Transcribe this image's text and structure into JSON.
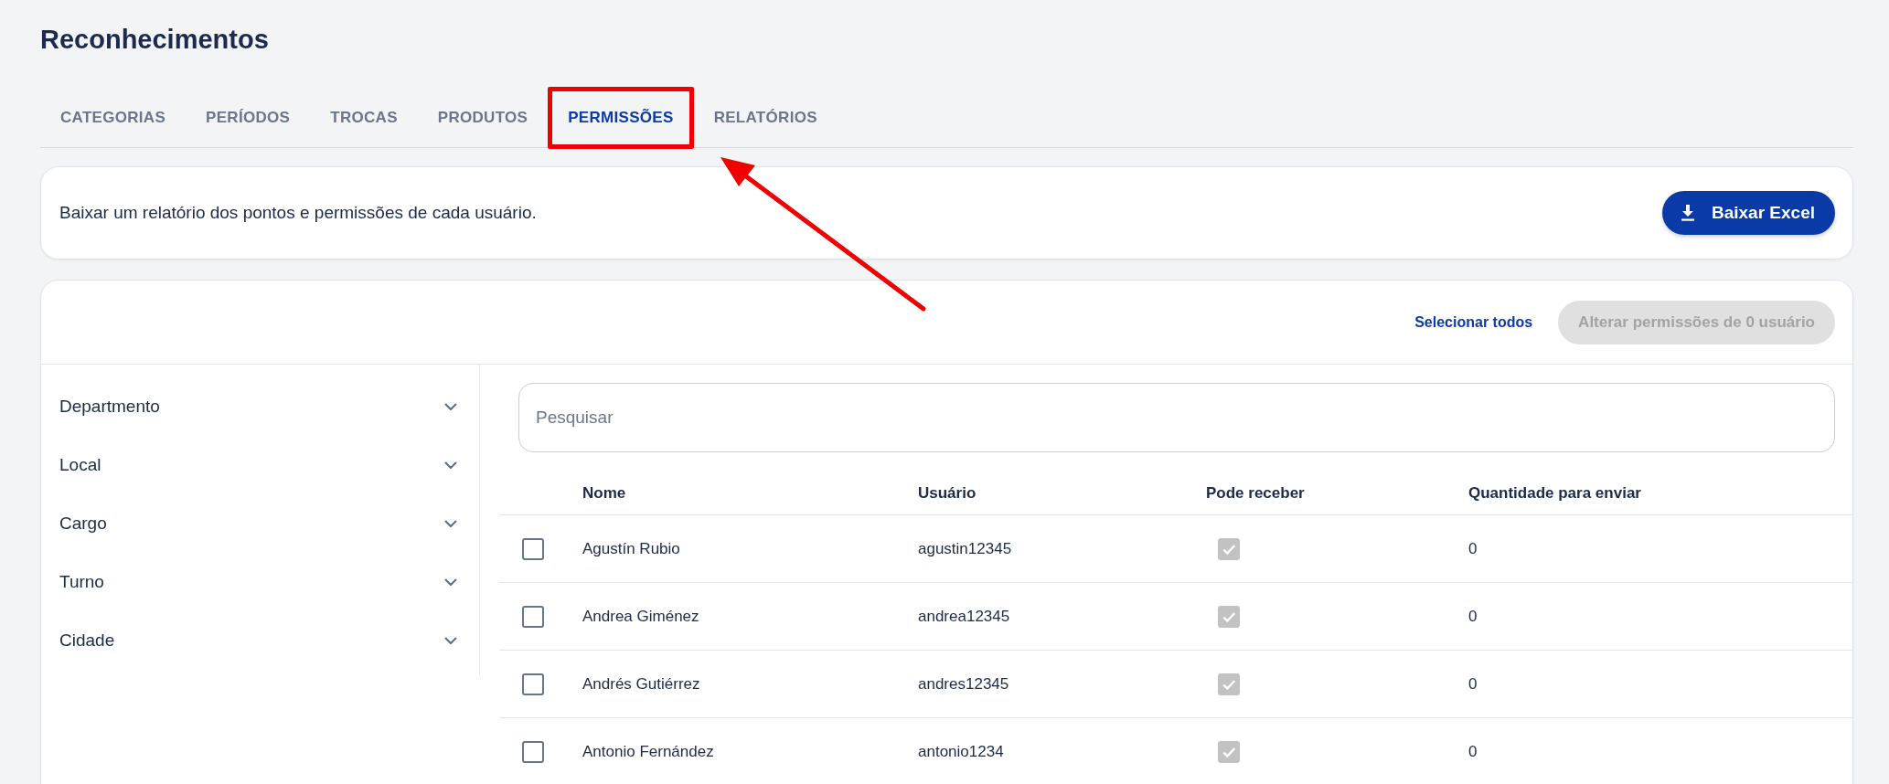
{
  "page": {
    "title": "Reconhecimentos"
  },
  "tabs": [
    {
      "label": "CATEGORIAS",
      "selected": false,
      "highlighted": false
    },
    {
      "label": "PERÍODOS",
      "selected": false,
      "highlighted": false
    },
    {
      "label": "TROCAS",
      "selected": false,
      "highlighted": false
    },
    {
      "label": "PRODUTOS",
      "selected": false,
      "highlighted": false
    },
    {
      "label": "PERMISSÕES",
      "selected": true,
      "highlighted": true
    },
    {
      "label": "RELATÓRIOS",
      "selected": false,
      "highlighted": false
    }
  ],
  "export_card": {
    "text": "Baixar um relatório dos pontos e permissões de cada usuário.",
    "button": "Baixar Excel"
  },
  "toolbar": {
    "select_all": "Selecionar todos",
    "change_button": {
      "label": "Alterar permissões de 0 usuário",
      "disabled": true
    }
  },
  "filters": [
    {
      "label": "Departmento",
      "expanded": false
    },
    {
      "label": "Local",
      "expanded": false
    },
    {
      "label": "Cargo",
      "expanded": false
    },
    {
      "label": "Turno",
      "expanded": false
    },
    {
      "label": "Cidade",
      "expanded": false
    }
  ],
  "search": {
    "placeholder": "Pesquisar"
  },
  "table": {
    "columns": [
      "Nome",
      "Usuário",
      "Pode receber",
      "Quantidade para enviar"
    ],
    "rows": [
      {
        "selected": false,
        "name": "Agustín Rubio",
        "user": "agustin12345",
        "can_receive": {
          "checked": true,
          "disabled": true
        },
        "quantity": "0"
      },
      {
        "selected": false,
        "name": "Andrea Giménez",
        "user": "andrea12345",
        "can_receive": {
          "checked": true,
          "disabled": true
        },
        "quantity": "0"
      },
      {
        "selected": false,
        "name": "Andrés Gutiérrez",
        "user": "andres12345",
        "can_receive": {
          "checked": true,
          "disabled": true
        },
        "quantity": "0"
      },
      {
        "selected": false,
        "name": "Antonio Fernández",
        "user": "antonio1234",
        "can_receive": {
          "checked": true,
          "disabled": true
        },
        "quantity": "0"
      }
    ]
  }
}
